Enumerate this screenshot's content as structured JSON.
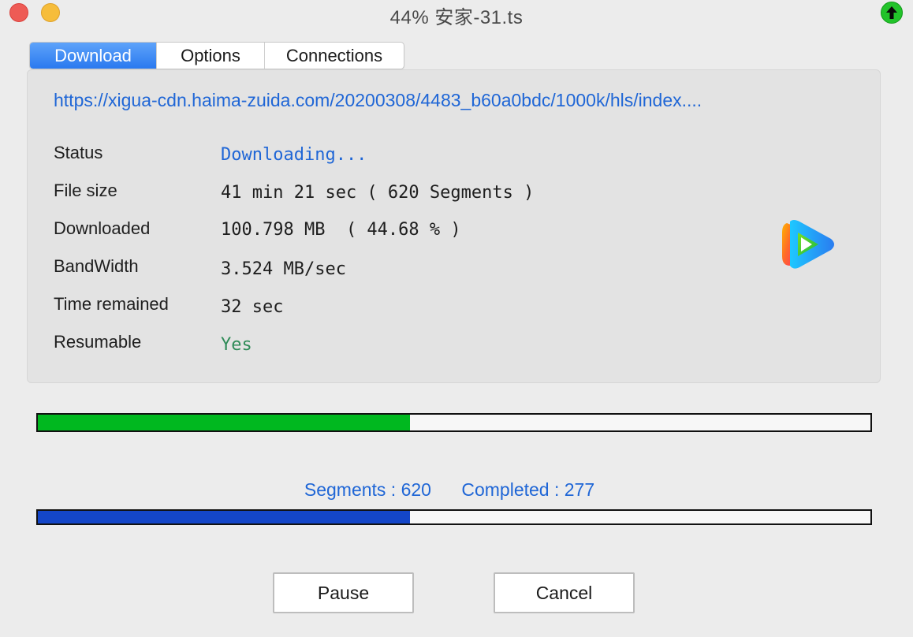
{
  "window": {
    "title": "44% 安家-31.ts",
    "close_button": "close",
    "minimize_button": "minimize"
  },
  "tabs": [
    {
      "label": "Download",
      "active": true
    },
    {
      "label": "Options",
      "active": false
    },
    {
      "label": "Connections",
      "active": false
    }
  ],
  "download": {
    "url": "https://xigua-cdn.haima-zuida.com/20200308/4483_b60a0bdc/1000k/hls/index....",
    "rows": [
      {
        "label": "Status",
        "value": "Downloading..."
      },
      {
        "label": "File size",
        "value": "41 min 21 sec ( 620 Segments )"
      },
      {
        "label": "Downloaded",
        "value": "100.798 MB  ( 44.68 % )"
      },
      {
        "label": "BandWidth",
        "value": "3.524 MB/sec"
      },
      {
        "label": "Time remained",
        "value": "32 sec"
      },
      {
        "label": "Resumable",
        "value": "Yes"
      }
    ]
  },
  "progress": {
    "download_fraction": 0.4468,
    "fill_color": "#00b81f"
  },
  "segments": {
    "segments_label": "Segments : 620",
    "completed_label": "Completed : 277",
    "total": 620,
    "completed": 277,
    "fill_color": "#1446c8"
  },
  "buttons": {
    "pause": "Pause",
    "cancel": "Cancel"
  },
  "colors": {
    "accent_blue": "#1f66d6",
    "resumable_green": "#2e8b57",
    "tab_active": "#2a79ef"
  }
}
